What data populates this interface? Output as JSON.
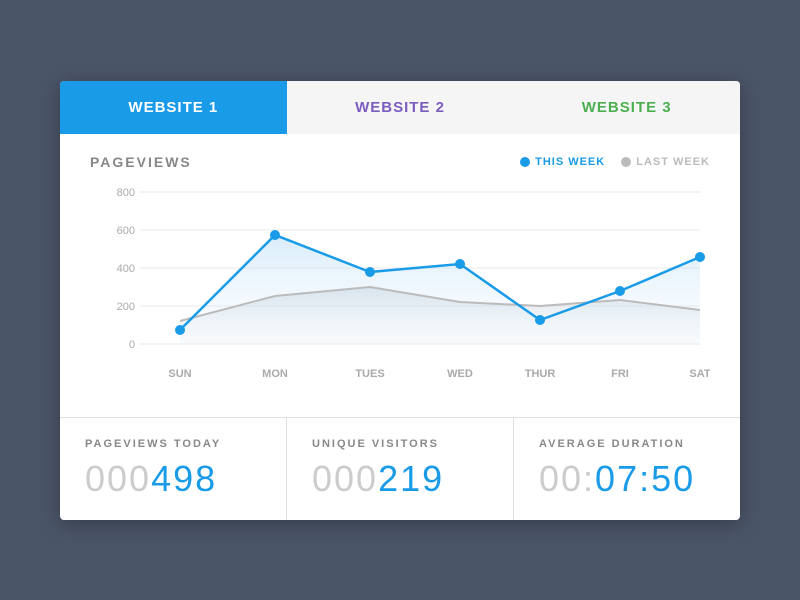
{
  "tabs": [
    {
      "id": "website1",
      "label": "WEBSITE 1",
      "active": true
    },
    {
      "id": "website2",
      "label": "WEBSITE 2",
      "active": false
    },
    {
      "id": "website3",
      "label": "WEBSITE 3",
      "active": false
    }
  ],
  "chart": {
    "title": "PAGEVIEWS",
    "legend": {
      "this_week": "THIS WEEK",
      "last_week": "LAST WEEK"
    },
    "y_labels": [
      "800",
      "600",
      "400",
      "200",
      "0"
    ],
    "x_labels": [
      "SUN",
      "MON",
      "TUES",
      "WED",
      "THUR",
      "FRI",
      "SAT"
    ],
    "this_week_data": [
      75,
      575,
      380,
      420,
      130,
      280,
      460
    ],
    "last_week_data": [
      120,
      250,
      300,
      220,
      200,
      230,
      180
    ]
  },
  "stats": [
    {
      "label": "PAGEVIEWS TODAY",
      "zeros": "000",
      "value": "498"
    },
    {
      "label": "UNIQUE VISITORS",
      "zeros": "000",
      "value": "219"
    },
    {
      "label": "AVERAGE DURATION",
      "zeros": "00:",
      "value": "07:50"
    }
  ]
}
